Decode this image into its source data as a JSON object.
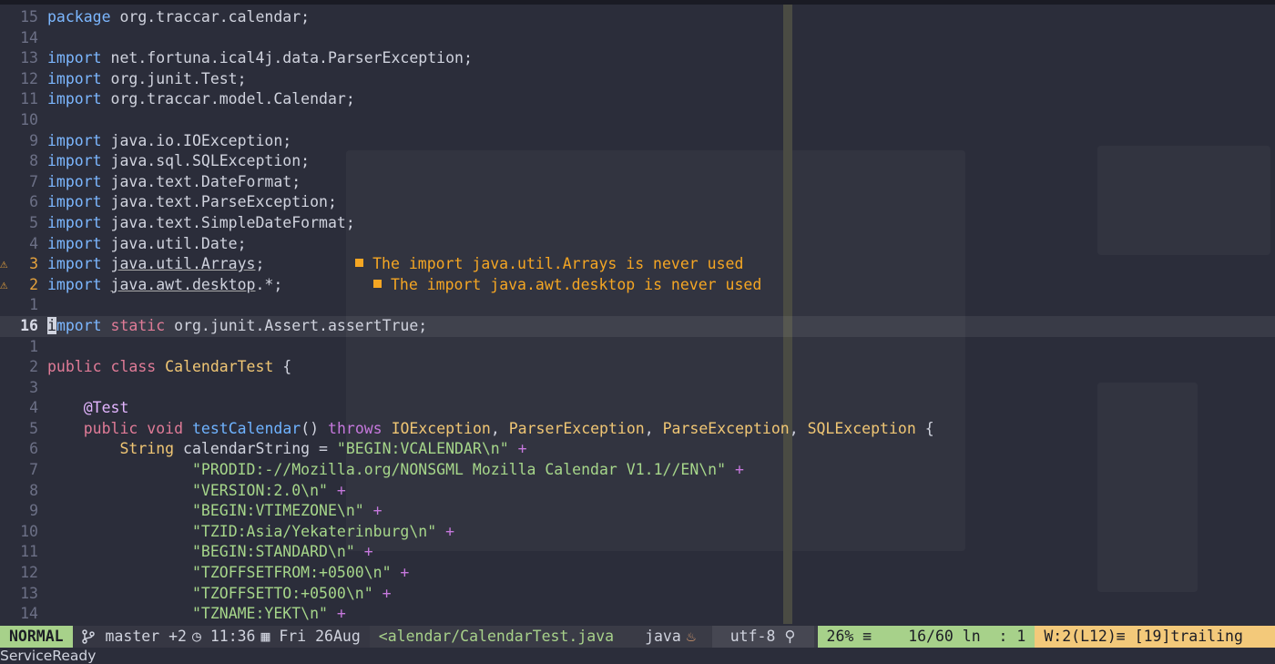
{
  "editor": {
    "lines": [
      {
        "num": "15",
        "sign": "",
        "tokens": [
          {
            "t": "package",
            "c": "kw"
          },
          {
            "t": " org.traccar.calendar;",
            "c": "plain"
          }
        ]
      },
      {
        "num": "14",
        "sign": "",
        "tokens": []
      },
      {
        "num": "13",
        "sign": "",
        "tokens": [
          {
            "t": "import",
            "c": "kw"
          },
          {
            "t": " net.fortuna.ical4j.data.ParserException;",
            "c": "plain"
          }
        ]
      },
      {
        "num": "12",
        "sign": "",
        "tokens": [
          {
            "t": "import",
            "c": "kw"
          },
          {
            "t": " org.junit.Test;",
            "c": "plain"
          }
        ]
      },
      {
        "num": "11",
        "sign": "",
        "tokens": [
          {
            "t": "import",
            "c": "kw"
          },
          {
            "t": " org.traccar.model.Calendar;",
            "c": "plain"
          }
        ]
      },
      {
        "num": "10",
        "sign": "",
        "tokens": []
      },
      {
        "num": "9",
        "sign": "",
        "tokens": [
          {
            "t": "import",
            "c": "kw"
          },
          {
            "t": " java.io.IOException;",
            "c": "plain"
          }
        ]
      },
      {
        "num": "8",
        "sign": "",
        "tokens": [
          {
            "t": "import",
            "c": "kw"
          },
          {
            "t": " java.sql.SQLException;",
            "c": "plain"
          }
        ]
      },
      {
        "num": "7",
        "sign": "",
        "tokens": [
          {
            "t": "import",
            "c": "kw"
          },
          {
            "t": " java.text.DateFormat;",
            "c": "plain"
          }
        ]
      },
      {
        "num": "6",
        "sign": "",
        "tokens": [
          {
            "t": "import",
            "c": "kw"
          },
          {
            "t": " java.text.ParseException;",
            "c": "plain"
          }
        ]
      },
      {
        "num": "5",
        "sign": "",
        "tokens": [
          {
            "t": "import",
            "c": "kw"
          },
          {
            "t": " java.text.SimpleDateFormat;",
            "c": "plain"
          }
        ]
      },
      {
        "num": "4",
        "sign": "",
        "tokens": [
          {
            "t": "import",
            "c": "kw"
          },
          {
            "t": " java.util.Date;",
            "c": "plain"
          }
        ]
      },
      {
        "num": "3",
        "sign": "⚠",
        "tokens": [
          {
            "t": "import",
            "c": "kw"
          },
          {
            "t": " ",
            "c": "plain"
          },
          {
            "t": "java.util.Arrays",
            "c": "plain warnimp"
          },
          {
            "t": ";     ",
            "c": "plain"
          }
        ],
        "diagnostic": "The import java.util.Arrays is never used"
      },
      {
        "num": "2",
        "sign": "⚠",
        "tokens": [
          {
            "t": "import",
            "c": "kw"
          },
          {
            "t": " ",
            "c": "plain"
          },
          {
            "t": "java.awt.desktop",
            "c": "plain warnimp"
          },
          {
            "t": ".*;",
            "c": "plain"
          },
          {
            "t": "     ",
            "c": "plain"
          }
        ],
        "diagnostic": "The import java.awt.desktop is never used"
      },
      {
        "num": "1",
        "sign": "",
        "tokens": []
      },
      {
        "num": "16",
        "sign": "",
        "current": true,
        "tokens": [
          {
            "t": "i",
            "c": "cursor"
          },
          {
            "t": "mport",
            "c": "kw"
          },
          {
            "t": " ",
            "c": "plain"
          },
          {
            "t": "static",
            "c": "kwp"
          },
          {
            "t": " org.junit.Assert.assertTrue;",
            "c": "plain"
          }
        ]
      },
      {
        "num": "1",
        "sign": "",
        "tokens": []
      },
      {
        "num": "2",
        "sign": "",
        "tokens": [
          {
            "t": "public",
            "c": "kwp"
          },
          {
            "t": " ",
            "c": "plain"
          },
          {
            "t": "class",
            "c": "kwp"
          },
          {
            "t": " ",
            "c": "plain"
          },
          {
            "t": "CalendarTest",
            "c": "cls"
          },
          {
            "t": " {",
            "c": "plain"
          }
        ]
      },
      {
        "num": "3",
        "sign": "",
        "tokens": []
      },
      {
        "num": "4",
        "sign": "",
        "tokens": [
          {
            "t": "    ",
            "c": "plain"
          },
          {
            "t": "@Test",
            "c": "ann"
          }
        ]
      },
      {
        "num": "5",
        "sign": "",
        "tokens": [
          {
            "t": "    ",
            "c": "plain"
          },
          {
            "t": "public",
            "c": "kwp"
          },
          {
            "t": " ",
            "c": "plain"
          },
          {
            "t": "void",
            "c": "kwp"
          },
          {
            "t": " ",
            "c": "plain"
          },
          {
            "t": "testCalendar",
            "c": "fn"
          },
          {
            "t": "() ",
            "c": "plain"
          },
          {
            "t": "throws",
            "c": "op"
          },
          {
            "t": " ",
            "c": "plain"
          },
          {
            "t": "IOException",
            "c": "cls"
          },
          {
            "t": ", ",
            "c": "plain"
          },
          {
            "t": "ParserException",
            "c": "cls"
          },
          {
            "t": ", ",
            "c": "plain"
          },
          {
            "t": "ParseException",
            "c": "cls"
          },
          {
            "t": ", ",
            "c": "plain"
          },
          {
            "t": "SQLException",
            "c": "cls"
          },
          {
            "t": " {",
            "c": "plain"
          }
        ]
      },
      {
        "num": "6",
        "sign": "",
        "tokens": [
          {
            "t": "        ",
            "c": "plain"
          },
          {
            "t": "String",
            "c": "cls"
          },
          {
            "t": " calendarString = ",
            "c": "plain"
          },
          {
            "t": "\"BEGIN:VCALENDAR\\n\"",
            "c": "str"
          },
          {
            "t": " +",
            "c": "op"
          }
        ]
      },
      {
        "num": "7",
        "sign": "",
        "tokens": [
          {
            "t": "                ",
            "c": "plain"
          },
          {
            "t": "\"PRODID:-//Mozilla.org/NONSGML Mozilla Calendar V1.1//EN\\n\"",
            "c": "str"
          },
          {
            "t": " +",
            "c": "op"
          }
        ]
      },
      {
        "num": "8",
        "sign": "",
        "tokens": [
          {
            "t": "                ",
            "c": "plain"
          },
          {
            "t": "\"VERSION:2.0\\n\"",
            "c": "str"
          },
          {
            "t": " +",
            "c": "op"
          }
        ]
      },
      {
        "num": "9",
        "sign": "",
        "tokens": [
          {
            "t": "                ",
            "c": "plain"
          },
          {
            "t": "\"BEGIN:VTIMEZONE\\n\"",
            "c": "str"
          },
          {
            "t": " +",
            "c": "op"
          }
        ]
      },
      {
        "num": "10",
        "sign": "",
        "tokens": [
          {
            "t": "                ",
            "c": "plain"
          },
          {
            "t": "\"TZID:Asia/Yekaterinburg\\n\"",
            "c": "str"
          },
          {
            "t": " +",
            "c": "op"
          }
        ]
      },
      {
        "num": "11",
        "sign": "",
        "tokens": [
          {
            "t": "                ",
            "c": "plain"
          },
          {
            "t": "\"BEGIN:STANDARD\\n\"",
            "c": "str"
          },
          {
            "t": " +",
            "c": "op"
          }
        ]
      },
      {
        "num": "12",
        "sign": "",
        "tokens": [
          {
            "t": "                ",
            "c": "plain"
          },
          {
            "t": "\"TZOFFSETFROM:+0500\\n\"",
            "c": "str"
          },
          {
            "t": " +",
            "c": "op"
          }
        ]
      },
      {
        "num": "13",
        "sign": "",
        "tokens": [
          {
            "t": "                ",
            "c": "plain"
          },
          {
            "t": "\"TZOFFSETTO:+0500\\n\"",
            "c": "str"
          },
          {
            "t": " +",
            "c": "op"
          }
        ]
      },
      {
        "num": "14",
        "sign": "",
        "tokens": [
          {
            "t": "                ",
            "c": "plain"
          },
          {
            "t": "\"TZNAME:YEKT\\n\"",
            "c": "str"
          },
          {
            "t": " +",
            "c": "op"
          }
        ]
      }
    ]
  },
  "statusline": {
    "mode": "NORMAL",
    "branch": " master +2",
    "clock_icon": "clock-icon",
    "time": " 11:36",
    "calendar_icon": "calendar-icon",
    "date": " Fri 26Aug",
    "file": "<alendar/CalendarTest.java",
    "filetype": "java",
    "filetype_icon": "java-icon",
    "encoding": "utf-8",
    "os_icon": "linux-icon",
    "percent": "26% ≡",
    "position": "16/60 ln  : 1",
    "warnings": "W:2(L12)≡ [19]trailing"
  },
  "message": "ServiceReady",
  "colors": {
    "mode_bg": "#a7d18a",
    "warning_bg": "#f3c97a",
    "diagnostic": "#f5a623"
  }
}
